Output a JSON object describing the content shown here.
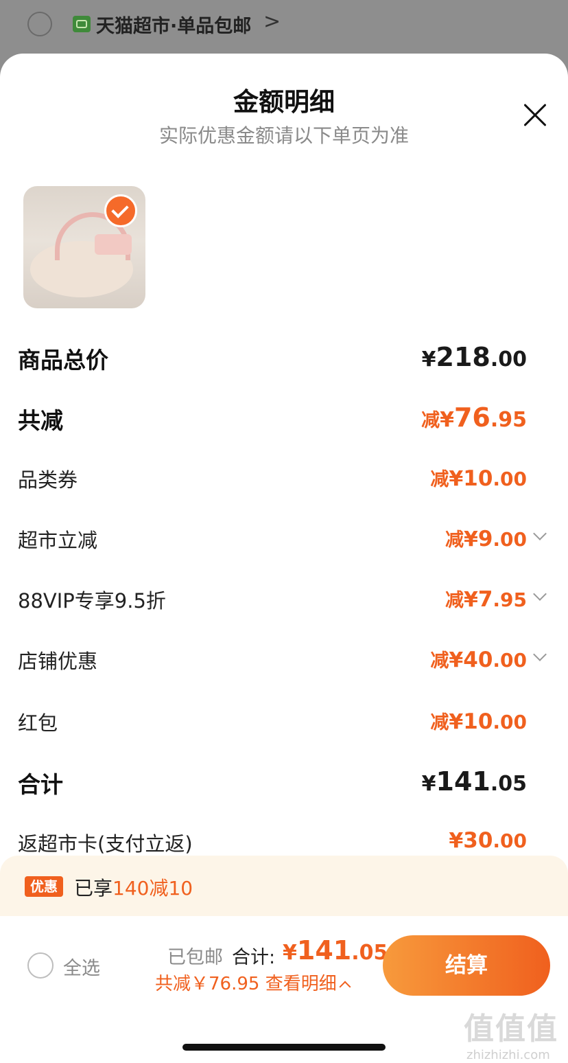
{
  "store": {
    "name": "天猫超市·单品包邮",
    "chevron": ">"
  },
  "sheet": {
    "title": "金额明细",
    "subtitle": "实际优惠金额请以下单页为准"
  },
  "rows": [
    {
      "label": "商品总价",
      "prefix": "",
      "currency": "¥",
      "int": "218",
      "dec": ".00"
    },
    {
      "label": "共减",
      "prefix": "减",
      "currency": "¥",
      "int": "76",
      "dec": ".95"
    },
    {
      "label": "品类券",
      "prefix": "减",
      "currency": "¥",
      "int": "10",
      "dec": ".00"
    },
    {
      "label": "超市立减",
      "prefix": "减",
      "currency": "¥",
      "int": "9",
      "dec": ".00"
    },
    {
      "label": "88VIP专享9.5折",
      "prefix": "减",
      "currency": "¥",
      "int": "7",
      "dec": ".95"
    },
    {
      "label": "店铺优惠",
      "prefix": "减",
      "currency": "¥",
      "int": "40",
      "dec": ".00"
    },
    {
      "label": "红包",
      "prefix": "减",
      "currency": "¥",
      "int": "10",
      "dec": ".00"
    },
    {
      "label": "合计",
      "prefix": "",
      "currency": "¥",
      "int": "141",
      "dec": ".05"
    },
    {
      "label": "返超市卡(支付立返)",
      "prefix": "",
      "currency": "¥",
      "int": "30",
      "dec": ".00"
    }
  ],
  "promo": {
    "tag": "优惠",
    "text": "已享",
    "highlight": "140减10"
  },
  "footer": {
    "select_all": "全选",
    "shipping": "已包邮",
    "total_label": "合计:",
    "total_currency": "¥",
    "total_int": "141",
    "total_dec": ".05",
    "reduce_text": "共减￥76.95 查看明细",
    "checkout": "结算"
  },
  "watermark": {
    "big": "值值值",
    "small": "zhizhizhi.com"
  },
  "colors": {
    "accent": "#f0601e",
    "checkout_gradient_start": "#f79a3c",
    "promo_bg": "#fdf5e8"
  }
}
